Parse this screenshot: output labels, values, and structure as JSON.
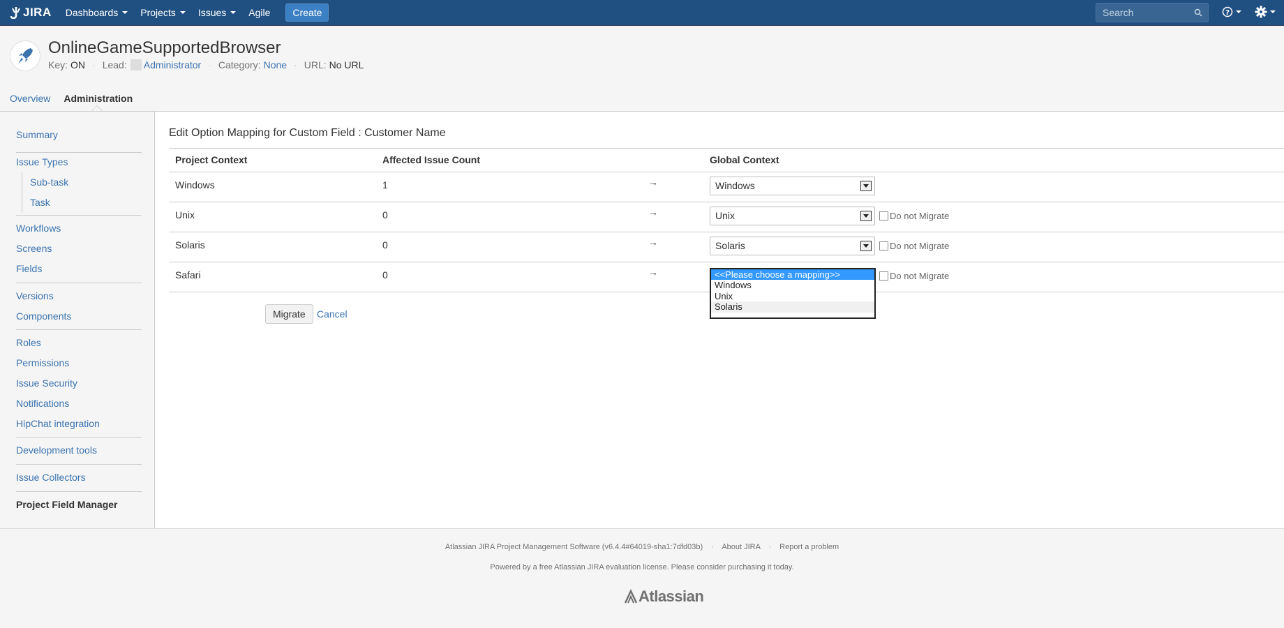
{
  "header": {
    "logo_text": "JIRA",
    "nav": [
      "Dashboards",
      "Projects",
      "Issues",
      "Agile"
    ],
    "create_label": "Create",
    "search_placeholder": "Search"
  },
  "project": {
    "name": "OnlineGameSupportedBrowser",
    "key_label": "Key:",
    "key_value": "ON",
    "lead_label": "Lead:",
    "lead_value": "Administrator",
    "category_label": "Category:",
    "category_value": "None",
    "url_label": "URL:",
    "url_value": "No URL"
  },
  "tabs": {
    "overview": "Overview",
    "administration": "Administration"
  },
  "sidebar": {
    "summary": "Summary",
    "issue_types": "Issue Types",
    "sub_task": "Sub-task",
    "task": "Task",
    "workflows": "Workflows",
    "screens": "Screens",
    "fields": "Fields",
    "versions": "Versions",
    "components": "Components",
    "roles": "Roles",
    "permissions": "Permissions",
    "issue_security": "Issue Security",
    "notifications": "Notifications",
    "hipchat": "HipChat integration",
    "dev_tools": "Development tools",
    "issue_collectors": "Issue Collectors",
    "project_field_manager": "Project Field Manager"
  },
  "main": {
    "title": "Edit Option Mapping for Custom Field : Customer Name",
    "columns": {
      "project_context": "Project Context",
      "affected_count": "Affected Issue Count",
      "global_context": "Global Context"
    },
    "arrow": "→",
    "do_not_migrate": "Do not Migrate",
    "rows": [
      {
        "context": "Windows",
        "count": "1",
        "mapping": "Windows"
      },
      {
        "context": "Unix",
        "count": "0",
        "mapping": "Unix"
      },
      {
        "context": "Solaris",
        "count": "0",
        "mapping": "Solaris"
      },
      {
        "context": "Safari",
        "count": "0",
        "mapping": "<<Please choose a mapping>>"
      }
    ],
    "listbox_options": [
      "<<Please choose a mapping>>",
      "Windows",
      "Unix",
      "Solaris"
    ],
    "migrate_label": "Migrate",
    "cancel_label": "Cancel"
  },
  "footer": {
    "software": "Atlassian JIRA Project Management Software (v6.4.4#64019-sha1:7dfd03b)",
    "about": "About JIRA",
    "report": "Report a problem",
    "license": "Powered by a free Atlassian JIRA evaluation license. Please consider purchasing it today.",
    "logo_text": "Atlassian"
  },
  "colors": {
    "header_bg": "#205081",
    "link": "#3b73af",
    "select_highlight": "#3399ff"
  }
}
